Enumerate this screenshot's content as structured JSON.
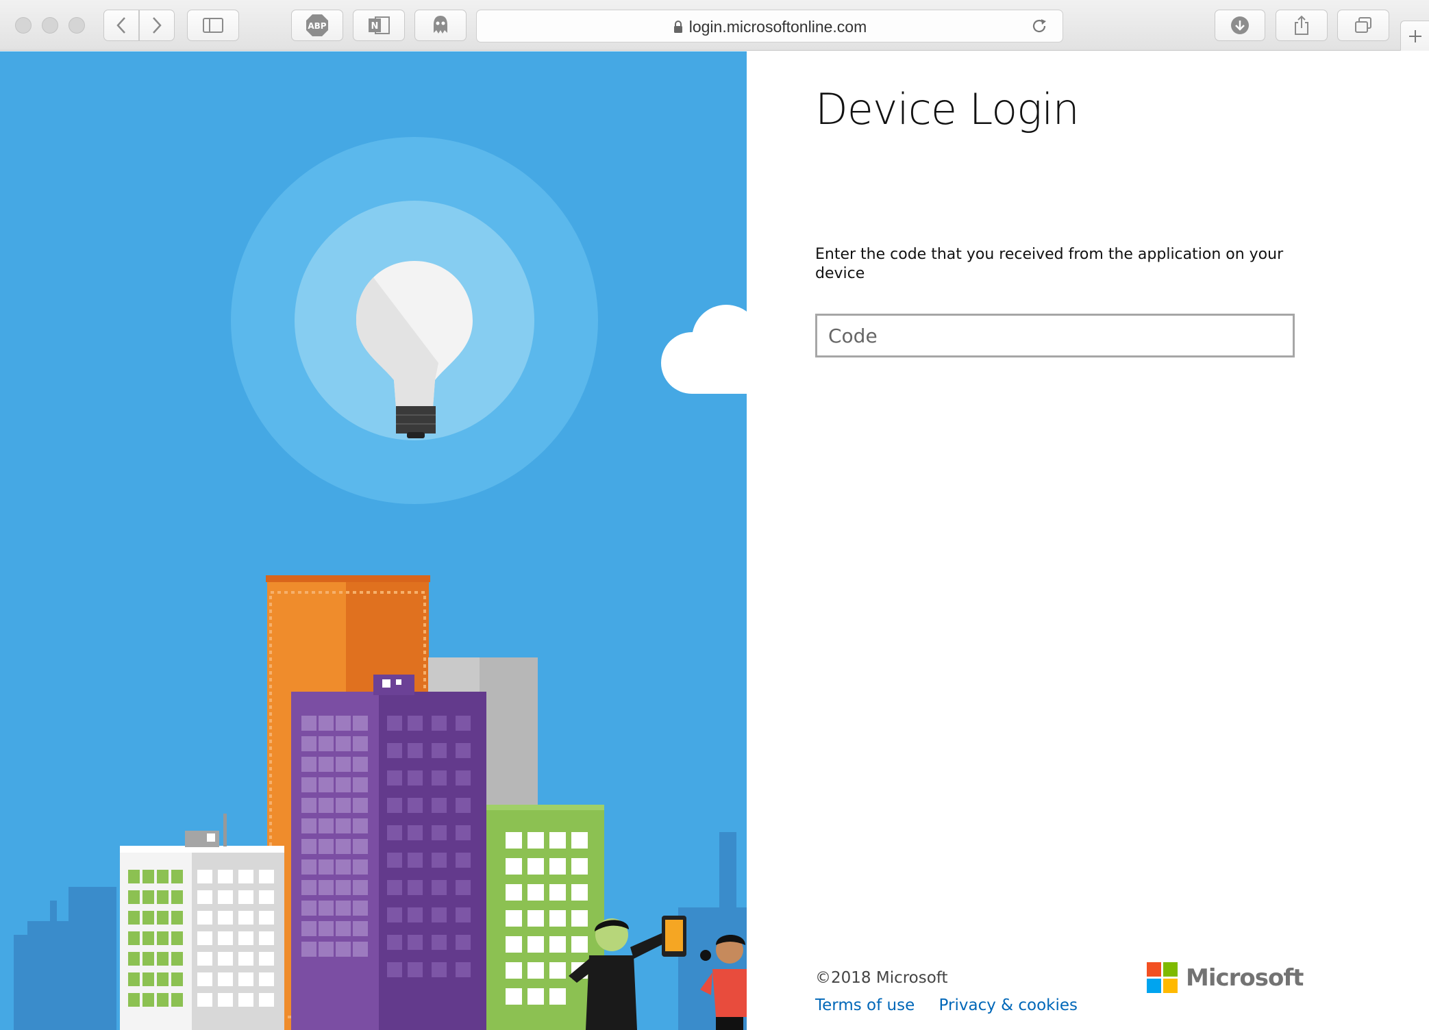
{
  "browser": {
    "url": "login.microsoftonline.com",
    "extensions": [
      "ABP",
      "N"
    ]
  },
  "login": {
    "title": "Device Login",
    "instruction": "Enter the code that you received from the application on your device",
    "code_placeholder": "Code",
    "code_value": ""
  },
  "footer": {
    "copyright": "©2018 Microsoft",
    "terms": "Terms of use",
    "privacy": "Privacy & cookies",
    "brand": "Microsoft"
  },
  "colors": {
    "background_blue": "#45a8e4",
    "link": "#0067b8",
    "ms_red": "#f25022",
    "ms_green": "#7fba00",
    "ms_blue": "#00a4ef",
    "ms_yellow": "#ffb900"
  }
}
